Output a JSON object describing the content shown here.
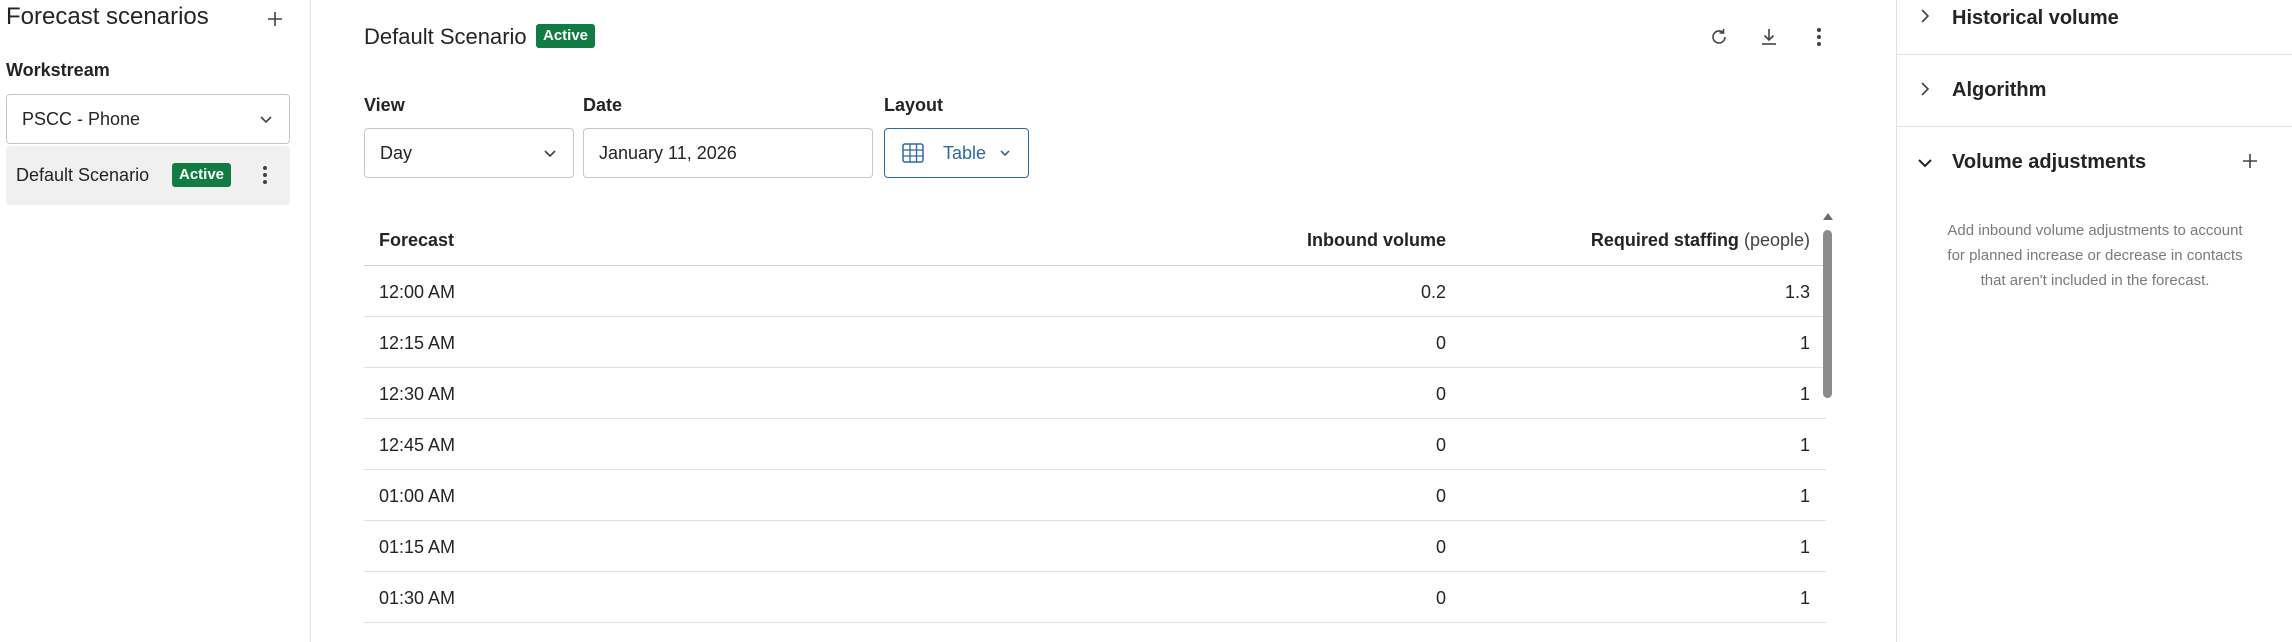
{
  "left": {
    "title": "Forecast scenarios",
    "workstream_label": "Workstream",
    "workstream_value": "PSCC - Phone",
    "scenarios": [
      {
        "name": "Default Scenario",
        "status": "Active"
      }
    ]
  },
  "main": {
    "title": "Default Scenario",
    "status": "Active",
    "view": {
      "label": "View",
      "value": "Day"
    },
    "date": {
      "label": "Date",
      "value": "January 11, 2026"
    },
    "layout": {
      "label": "Layout",
      "value": "Table"
    },
    "table": {
      "columns": [
        "Forecast",
        "Inbound volume",
        "Required staffing",
        "(people)"
      ],
      "rows": [
        [
          "12:00 AM",
          "0.2",
          "1.3"
        ],
        [
          "12:15 AM",
          "0",
          "1"
        ],
        [
          "12:30 AM",
          "0",
          "1"
        ],
        [
          "12:45 AM",
          "0",
          "1"
        ],
        [
          "01:00 AM",
          "0",
          "1"
        ],
        [
          "01:15 AM",
          "0",
          "1"
        ],
        [
          "01:30 AM",
          "0",
          "1"
        ]
      ]
    }
  },
  "right": {
    "sections": {
      "historical": "Historical volume",
      "algorithm": "Algorithm",
      "volume_adjustments": "Volume adjustments"
    },
    "hint": "Add inbound volume adjustments to account for planned increase or decrease in contacts that aren't included in the forecast."
  },
  "colors": {
    "active_badge": "#107c41",
    "accent": "#2b6aa3"
  }
}
